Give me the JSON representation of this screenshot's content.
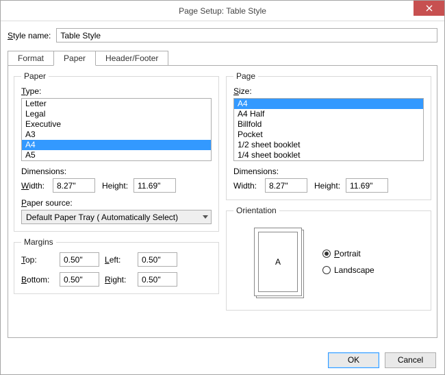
{
  "window": {
    "title": "Page Setup: Table Style"
  },
  "style_name": {
    "label": "Style name:",
    "value": "Table Style"
  },
  "tabs": {
    "format": "Format",
    "paper": "Paper",
    "header_footer": "Header/Footer"
  },
  "paper_group": {
    "legend": "Paper",
    "type_label": "Type:",
    "types": [
      "Letter",
      "Legal",
      "Executive",
      "A3",
      "A4",
      "A5"
    ],
    "type_selected": "A4",
    "dimensions_label": "Dimensions:",
    "width_label": "Width:",
    "width_value": "8.27\"",
    "height_label": "Height:",
    "height_value": "11.69\"",
    "source_label": "Paper source:",
    "source_value": "Default Paper Tray ( Automatically Select)"
  },
  "margins_group": {
    "legend": "Margins",
    "top_label": "Top:",
    "top_value": "0.50\"",
    "left_label": "Left:",
    "left_value": "0.50\"",
    "bottom_label": "Bottom:",
    "bottom_value": "0.50\"",
    "right_label": "Right:",
    "right_value": "0.50\""
  },
  "page_group": {
    "legend": "Page",
    "size_label": "Size:",
    "sizes": [
      "A4",
      "A4 Half",
      "Billfold",
      "Pocket",
      "1/2 sheet booklet",
      "1/4 sheet booklet"
    ],
    "size_selected": "A4",
    "dimensions_label": "Dimensions:",
    "width_label": "Width:",
    "width_value": "8.27\"",
    "height_label": "Height:",
    "height_value": "11.69\""
  },
  "orientation_group": {
    "legend": "Orientation",
    "preview_letter": "A",
    "portrait_label": "Portrait",
    "landscape_label": "Landscape",
    "selected": "portrait"
  },
  "buttons": {
    "ok": "OK",
    "cancel": "Cancel"
  }
}
